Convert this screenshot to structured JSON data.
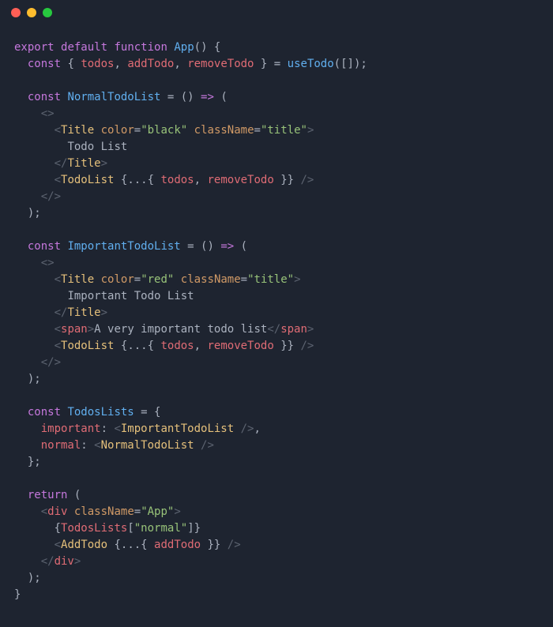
{
  "titlebar": {
    "red": "close",
    "yellow": "minimize",
    "green": "zoom"
  },
  "code": {
    "l1": {
      "kw1": "export",
      "kw2": "default",
      "kw3": "function",
      "fn": "App",
      "tail": "() {"
    },
    "l2": {
      "kw": "const",
      "destr": " { ",
      "v1": "todos",
      "c1": ", ",
      "v2": "addTodo",
      "c2": ", ",
      "v3": "removeTodo",
      "destr2": " } ",
      "eq": "= ",
      "fn": "useTodo",
      "args": "([]);"
    },
    "l4": {
      "kw": "const",
      "name": " NormalTodoList",
      "rest": " = () ",
      "arrow": "=>",
      "open": " ("
    },
    "l5": {
      "open": "<>"
    },
    "l6": {
      "open": "<",
      "tag": "Title",
      "sp": " ",
      "a1": "color",
      "eq1": "=",
      "v1": "\"black\"",
      "sp2": " ",
      "a2": "className",
      "eq2": "=",
      "v2": "\"title\"",
      "close": ">"
    },
    "l7": {
      "text": "Todo List"
    },
    "l8": {
      "open": "</",
      "tag": "Title",
      "close": ">"
    },
    "l9": {
      "open": "<",
      "tag": "TodoList",
      "sp": " ",
      "spread": "{...{ ",
      "v1": "todos",
      "c1": ", ",
      "v2": "removeTodo",
      "end": " }}",
      "close": " />"
    },
    "l10": {
      "close": "</>"
    },
    "l11": {
      "close": ");"
    },
    "l13": {
      "kw": "const",
      "name": " ImportantTodoList",
      "rest": " = () ",
      "arrow": "=>",
      "open": " ("
    },
    "l14": {
      "open": "<>"
    },
    "l15": {
      "open": "<",
      "tag": "Title",
      "sp": " ",
      "a1": "color",
      "eq1": "=",
      "v1": "\"red\"",
      "sp2": " ",
      "a2": "className",
      "eq2": "=",
      "v2": "\"title\"",
      "close": ">"
    },
    "l16": {
      "text": "Important Todo List"
    },
    "l17": {
      "open": "</",
      "tag": "Title",
      "close": ">"
    },
    "l18": {
      "open": "<",
      "tag": "span",
      "close1": ">",
      "text": "A very important todo list",
      "open2": "</",
      "tag2": "span",
      "close2": ">"
    },
    "l19": {
      "open": "<",
      "tag": "TodoList",
      "sp": " ",
      "spread": "{...{ ",
      "v1": "todos",
      "c1": ", ",
      "v2": "removeTodo",
      "end": " }}",
      "close": " />"
    },
    "l20": {
      "close": "</>"
    },
    "l21": {
      "close": ");"
    },
    "l23": {
      "kw": "const",
      "name": " TodosLists",
      "rest": " = {"
    },
    "l24": {
      "key": "important",
      "colon": ": ",
      "open": "<",
      "tag": "ImportantTodoList",
      "close": " />",
      "comma": ","
    },
    "l25": {
      "key": "normal",
      "colon": ": ",
      "open": "<",
      "tag": "NormalTodoList",
      "close": " />"
    },
    "l26": {
      "close": "};"
    },
    "l28": {
      "kw": "return",
      "open": " ("
    },
    "l29": {
      "open": "<",
      "tag": "div",
      "sp": " ",
      "a1": "className",
      "eq1": "=",
      "v1": "\"App\"",
      "close": ">"
    },
    "l30": {
      "open": "{",
      "name": "TodosLists",
      "bracket": "[",
      "key": "\"normal\"",
      "bracket2": "]",
      "close": "}"
    },
    "l31": {
      "open": "<",
      "tag": "AddTodo",
      "sp": " ",
      "spread": "{...{ ",
      "v1": "addTodo",
      "end": " }}",
      "close": " />"
    },
    "l32": {
      "open": "</",
      "tag": "div",
      "close": ">"
    },
    "l33": {
      "close": ");"
    },
    "l34": {
      "close": "}"
    }
  }
}
